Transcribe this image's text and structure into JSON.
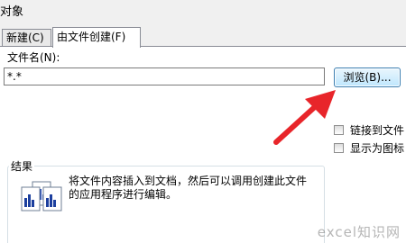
{
  "window": {
    "title_fragment": "对象"
  },
  "tabs": [
    {
      "label": "新建(C)",
      "active": false
    },
    {
      "label": "由文件创建(F)",
      "active": true
    }
  ],
  "file_section": {
    "label": "文件名(N):",
    "value": "*.*",
    "browse_label": "浏览(B)..."
  },
  "options": {
    "link_label": "链接到文件",
    "link_checked": false,
    "icon_label": "显示为图标",
    "icon_checked": false
  },
  "result": {
    "heading": "结果",
    "text": "将文件内容插入到文档，然后可以调用创建此文件的应用程序进行编辑。"
  },
  "watermark": "excel知识网",
  "colors": {
    "accent_arrow": "#e8252a",
    "button_border": "#3c7fb1"
  }
}
